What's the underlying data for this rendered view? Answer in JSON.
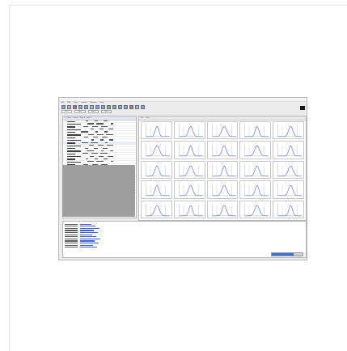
{
  "window": {
    "title": "",
    "menus": [
      "File",
      "Edit",
      "View",
      "Options",
      "Window",
      "Help"
    ],
    "tabs": [
      "Tab 1",
      "Tab 2",
      "Tab 3",
      "Tab 4"
    ]
  },
  "toolbar": {
    "buttons": [
      "open-icon",
      "save-icon",
      "print-icon",
      "undo-icon",
      "redo-icon",
      "cut-icon",
      "copy-icon",
      "paste-icon",
      "zoom-in-icon",
      "zoom-out-icon",
      "fit-icon",
      "chart-icon",
      "run-icon",
      "stop-icon",
      "filter-icon"
    ],
    "label": ""
  },
  "left_pane": {
    "headers": [
      "#",
      "Name",
      "Value A",
      "Value B",
      "Value C"
    ],
    "row_count": 27
  },
  "plots_header": {
    "tabs": [
      "Plot",
      "View"
    ]
  },
  "plot_grid": {
    "rows": 5,
    "cols": 5
  },
  "log": {
    "lines": 12
  },
  "status": {
    "progress": 0.72
  }
}
